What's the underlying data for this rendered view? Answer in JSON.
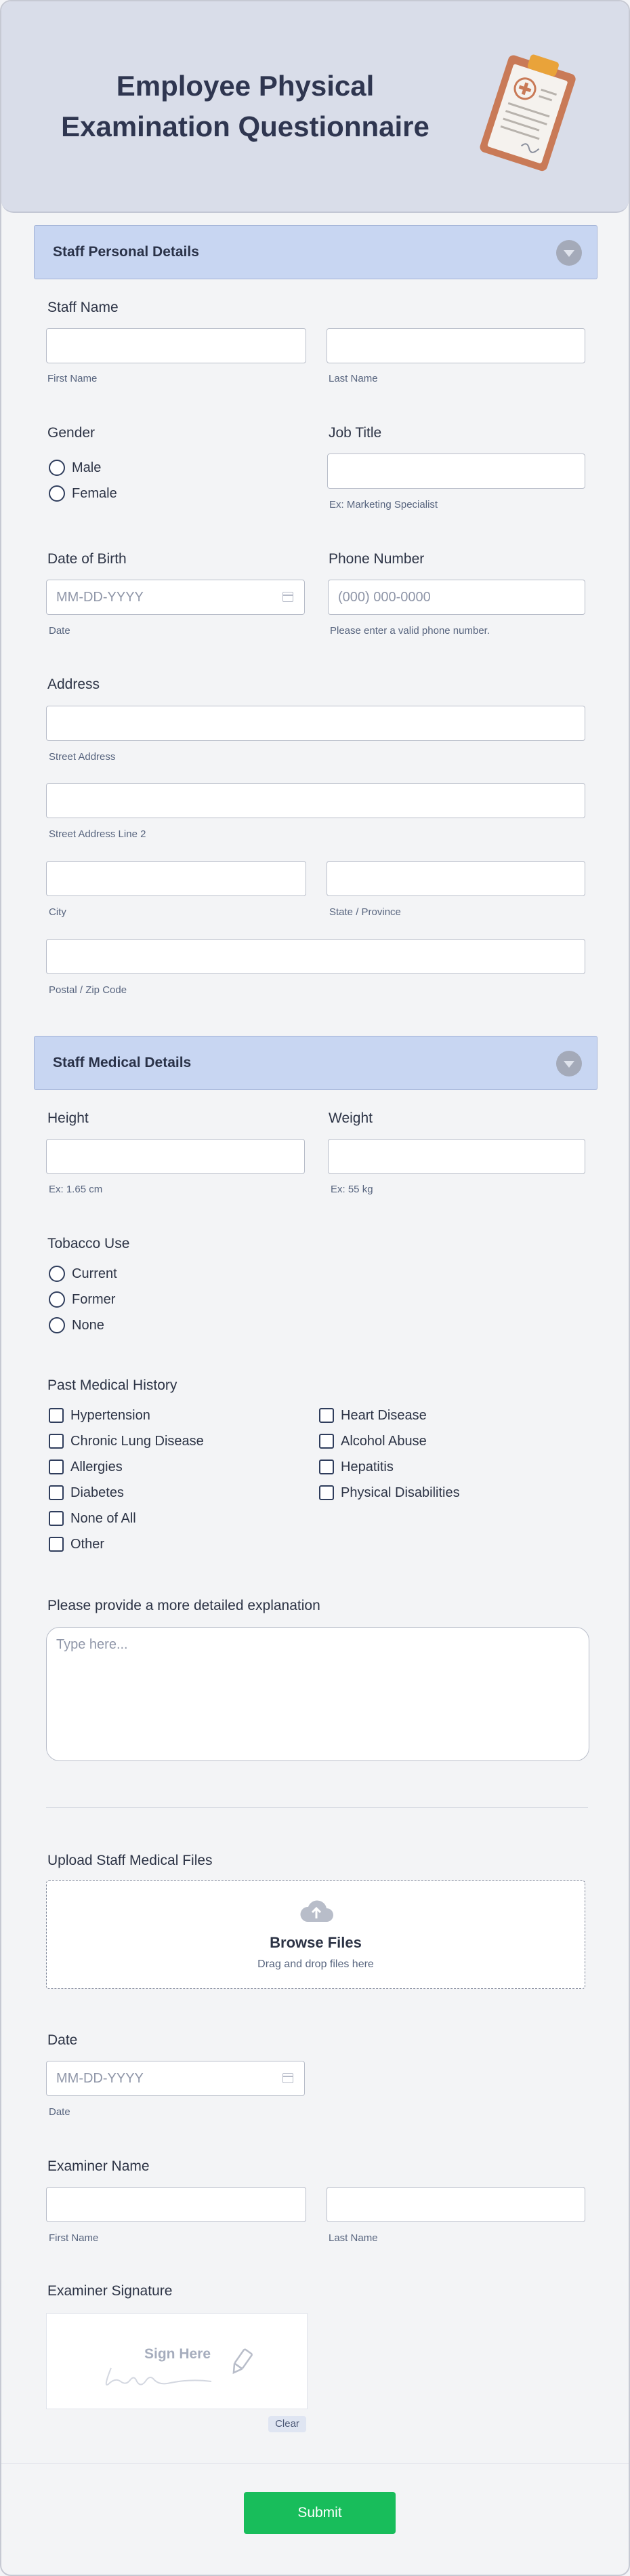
{
  "header": {
    "title": "Employee Physical Examination Questionnaire"
  },
  "section_personal": {
    "title": "Staff Personal Details",
    "staff_name": {
      "label": "Staff Name",
      "first_sub": "First Name",
      "last_sub": "Last Name",
      "first_value": "",
      "last_value": ""
    },
    "gender": {
      "label": "Gender",
      "options": [
        "Male",
        "Female"
      ]
    },
    "job_title": {
      "label": "Job Title",
      "value": "",
      "sub": "Ex: Marketing Specialist"
    },
    "dob": {
      "label": "Date of Birth",
      "placeholder": "MM-DD-YYYY",
      "sub": "Date"
    },
    "phone": {
      "label": "Phone Number",
      "placeholder": "(000) 000-0000",
      "sub": "Please enter a valid phone number."
    },
    "address": {
      "label": "Address",
      "street_sub": "Street Address",
      "street2_sub": "Street Address Line 2",
      "city_sub": "City",
      "state_sub": "State / Province",
      "postal_sub": "Postal / Zip Code"
    }
  },
  "section_medical": {
    "title": "Staff Medical Details",
    "height": {
      "label": "Height",
      "sub": "Ex: 1.65 cm"
    },
    "weight": {
      "label": "Weight",
      "sub": "Ex: 55 kg"
    },
    "tobacco": {
      "label": "Tobacco Use",
      "options": [
        "Current",
        "Former",
        "None"
      ]
    },
    "history": {
      "label": "Past Medical History",
      "left": [
        "Hypertension",
        "Chronic Lung Disease",
        "Allergies",
        "Diabetes",
        "None of All",
        "Other"
      ],
      "right": [
        "Heart Disease",
        "Alcohol Abuse",
        "Hepatitis",
        "Physical Disabilities"
      ]
    },
    "explanation": {
      "label": "Please provide a more detailed explanation",
      "placeholder": "Type here..."
    }
  },
  "upload": {
    "label": "Upload Staff Medical Files",
    "browse": "Browse Files",
    "drag": "Drag and drop files here"
  },
  "exam_date": {
    "label": "Date",
    "placeholder": "MM-DD-YYYY",
    "sub": "Date"
  },
  "examiner": {
    "label": "Examiner Name",
    "first_sub": "First Name",
    "last_sub": "Last Name"
  },
  "signature": {
    "label": "Examiner Signature",
    "sign_here": "Sign Here",
    "clear": "Clear"
  },
  "submit_label": "Submit",
  "colors": {
    "section_bg": "#c8d6f2",
    "submit": "#18bd5b",
    "header_bg": "#d9dde9"
  }
}
